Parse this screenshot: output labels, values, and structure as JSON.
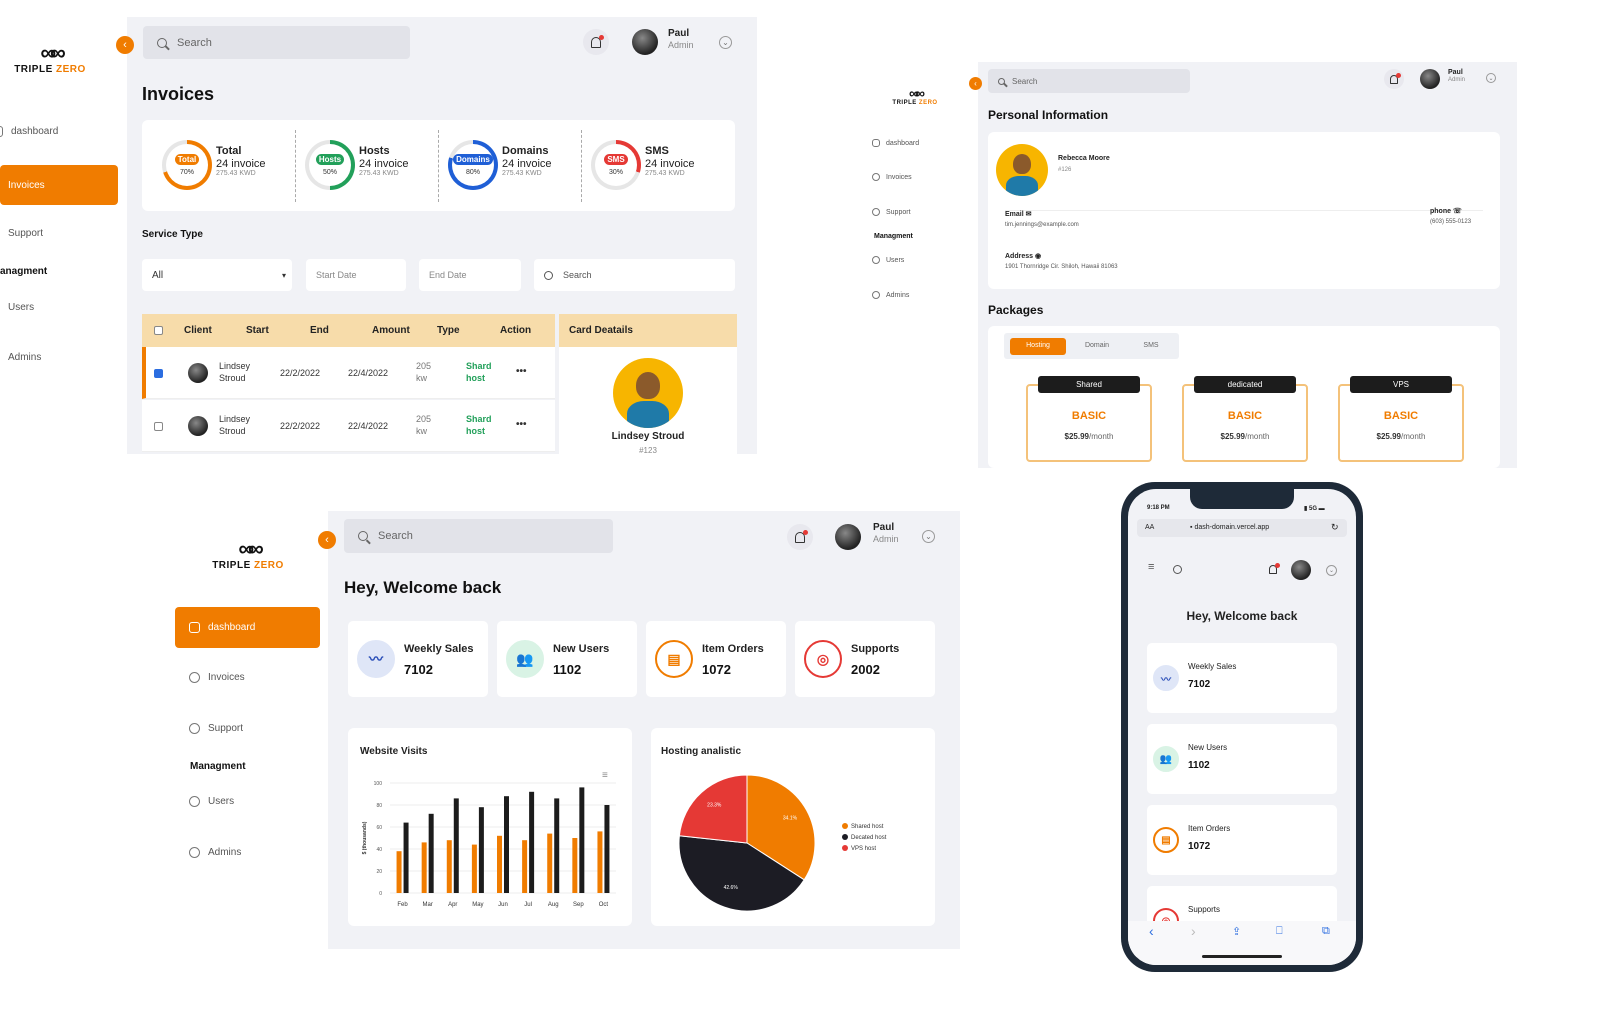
{
  "brand": {
    "name_part1": "TRIPLE",
    "name_part2": "ZERO",
    "mark": "∞∞"
  },
  "user": {
    "name": "Paul",
    "role": "Admin"
  },
  "search_placeholder": "Search",
  "nav": {
    "dashboard": "dashboard",
    "invoices": "Invoices",
    "support": "Support",
    "management": "Managment",
    "users": "Users",
    "admins": "Admins"
  },
  "invoices_screen": {
    "title": "Invoices",
    "nav_management": "anagment",
    "stats": [
      {
        "label": "Total",
        "count": "24 invoice",
        "amount": "275.43 KWD",
        "pct": "70%",
        "percent": 70,
        "color": "#f07c00"
      },
      {
        "label": "Hosts",
        "count": "24 invoice",
        "amount": "275.43 KWD",
        "pct": "50%",
        "percent": 50,
        "color": "#22a05a"
      },
      {
        "label": "Domains",
        "count": "24 invoice",
        "amount": "275.43 KWD",
        "pct": "80%",
        "percent": 80,
        "color": "#1f5fd6"
      },
      {
        "label": "SMS",
        "count": "24 invoice",
        "amount": "275.43 KWD",
        "pct": "30%",
        "percent": 30,
        "color": "#e53935"
      }
    ],
    "service_type_label": "Service Type",
    "service_type_value": "All",
    "start_date": "Start Date",
    "end_date": "End Date",
    "search": "Search",
    "columns": [
      "Client",
      "Start",
      "End",
      "Amount",
      "Type",
      "Action"
    ],
    "rows": [
      {
        "name1": "Lindsey",
        "name2": "Stroud",
        "start": "22/2/2022",
        "end": "22/4/2022",
        "amount1": "205",
        "amount2": "kw",
        "type1": "Shard",
        "type2": "host",
        "checked": true
      },
      {
        "name1": "Lindsey",
        "name2": "Stroud",
        "start": "22/2/2022",
        "end": "22/4/2022",
        "amount1": "205",
        "amount2": "kw",
        "type1": "Shard",
        "type2": "host",
        "checked": false
      }
    ],
    "card_details_title": "Card Deatails",
    "card_name": "Lindsey Stroud",
    "card_id": "#123"
  },
  "profile_screen": {
    "title": "Personal Information",
    "name": "Rebecca Moore",
    "id": "#126",
    "email_label": "Email",
    "email": "tim.jennings@example.com",
    "phone_label": "phone",
    "phone": "(603) 555-0123",
    "address_label": "Address",
    "address": "1901 Thornridge Cir. Shiloh, Hawaii 81063",
    "packages_title": "Packages",
    "tabs": [
      "Hosting",
      "Domain",
      "SMS"
    ],
    "packages": [
      {
        "tag": "Shared",
        "name": "BASIC",
        "price": "$25.99",
        "per": "/month"
      },
      {
        "tag": "dedicated",
        "name": "BASIC",
        "price": "$25.99",
        "per": "/month"
      },
      {
        "tag": "VPS",
        "name": "BASIC",
        "price": "$25.99",
        "per": "/month"
      }
    ]
  },
  "dashboard_screen": {
    "title": "Hey, Welcome back",
    "stats": [
      {
        "label": "Weekly Sales",
        "value": "7102",
        "icon": "trend-icon",
        "color": "#2b4fb8",
        "bg": "#dfe6f7"
      },
      {
        "label": "New Users",
        "value": "1102",
        "icon": "users-icon",
        "color": "#22a05a",
        "bg": "#d9f3e5"
      },
      {
        "label": "Item Orders",
        "value": "1072",
        "icon": "clipboard-icon",
        "color": "#f07c00",
        "bg": "#fff"
      },
      {
        "label": "Supports",
        "value": "2002",
        "icon": "support-icon",
        "color": "#e53935",
        "bg": "#fff"
      }
    ],
    "visits_title": "Website Visits",
    "hosting_title": "Hosting analistic"
  },
  "mobile": {
    "time": "9:18 PM",
    "signal": "5G",
    "aa": "AA",
    "url": "dash-domain.vercel.app",
    "title": "Hey, Welcome back",
    "stats": [
      {
        "label": "Weekly Sales",
        "value": "7102"
      },
      {
        "label": "New Users",
        "value": "1102"
      },
      {
        "label": "Item Orders",
        "value": "1072"
      },
      {
        "label": "Supports",
        "value": ""
      }
    ]
  },
  "chart_data": [
    {
      "type": "bar",
      "title": "Website Visits",
      "ylabel": "$ (thousands)",
      "ylim": [
        0,
        100
      ],
      "yticks": [
        0,
        20,
        40,
        60,
        80,
        100
      ],
      "categories": [
        "Feb",
        "Mar",
        "Apr",
        "May",
        "Jun",
        "Jul",
        "Aug",
        "Sep",
        "Oct"
      ],
      "series": [
        {
          "values": [
            38,
            46,
            48,
            44,
            52,
            48,
            54,
            50,
            56
          ],
          "color": "#f07c00"
        },
        {
          "values": [
            64,
            72,
            86,
            78,
            88,
            92,
            86,
            96,
            80
          ],
          "color": "#1c1c1c"
        }
      ],
      "legend": "none"
    },
    {
      "type": "pie",
      "title": "Hosting analistic",
      "slices": [
        {
          "label": "Shared host",
          "value": 34.1,
          "display": "34.1%",
          "color": "#f07c00"
        },
        {
          "label": "Decated host",
          "value": 42.6,
          "display": "42.6%",
          "color": "#1c1c24"
        },
        {
          "label": "VPS host",
          "value": 23.3,
          "display": "23.3%",
          "color": "#e53935"
        }
      ],
      "legend": "right"
    }
  ]
}
